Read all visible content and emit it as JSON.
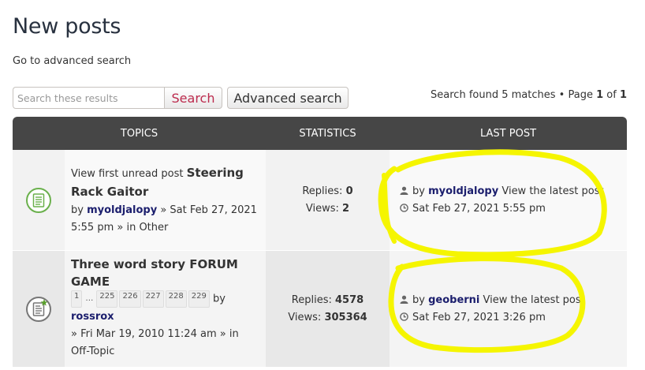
{
  "page": {
    "title": "New posts",
    "advanced_link": "Go to advanced search"
  },
  "search": {
    "placeholder": "Search these results",
    "button": "Search",
    "advanced_button": "Advanced search"
  },
  "pagination": {
    "found": "Search found 5 matches",
    "bullet": "•",
    "page_word": "Page",
    "current": "1",
    "of_word": "of",
    "total": "1"
  },
  "table": {
    "headers": {
      "topics": "TOPICS",
      "statistics": "STATISTICS",
      "last_post": "LAST POST"
    },
    "rows": [
      {
        "icon": "topic-unread-icon",
        "unread_link": "View first unread post",
        "title": "Steering Rack Gaitor",
        "by": "by",
        "author": "myoldjalopy",
        "posted": "» Sat Feb 27, 2021 5:55 pm » in",
        "forum": "Other",
        "replies_label": "Replies:",
        "replies": "0",
        "views_label": "Views:",
        "views": "2",
        "last_by": "by",
        "last_user": "myoldjalopy",
        "last_view": "View the latest post",
        "last_time": "Sat Feb 27, 2021 5:55 pm"
      },
      {
        "icon": "topic-hot-icon",
        "title": "Three word story FORUM GAME",
        "pages": [
          "1",
          "…",
          "225",
          "226",
          "227",
          "228",
          "229"
        ],
        "by": "by",
        "author": "rossrox",
        "posted": "» Fri Mar 19, 2010 11:24 am » in",
        "forum": "Off-Topic",
        "replies_label": "Replies:",
        "replies": "4578",
        "views_label": "Views:",
        "views": "305364",
        "last_by": "by",
        "last_user": "geoberni",
        "last_view": "View the latest post",
        "last_time": "Sat Feb 27, 2021 3:26 pm"
      }
    ]
  },
  "colors": {
    "header_bg": "#464646",
    "username": "#1b1e6d",
    "search_red": "#bc2a4d",
    "highlight": "#f5f500"
  }
}
